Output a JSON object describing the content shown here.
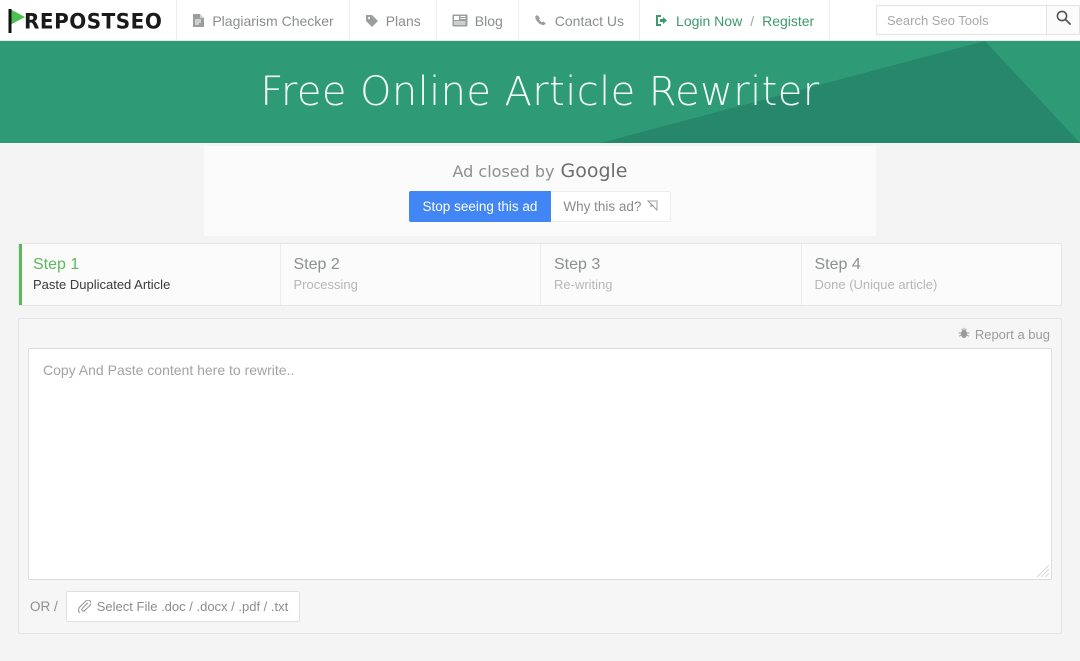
{
  "header": {
    "logo_text": "REPOSTSEO",
    "logo_prefix": "P",
    "nav": [
      {
        "label": "Plagiarism Checker",
        "icon": "document-icon"
      },
      {
        "label": "Plans",
        "icon": "tag-icon"
      },
      {
        "label": "Blog",
        "icon": "newspaper-icon"
      },
      {
        "label": "Contact Us",
        "icon": "phone-icon"
      }
    ],
    "login": {
      "label": "Login Now",
      "separator": "/",
      "register_label": "Register",
      "icon": "sign-in-icon"
    },
    "search": {
      "placeholder": "Search Seo Tools",
      "value": "",
      "icon": "search-icon"
    }
  },
  "hero": {
    "title": "Free Online Article Rewriter",
    "bg_color": "#2e9b76",
    "accent_color": "#27876a"
  },
  "ad": {
    "closed_text": "Ad closed by",
    "brand": "Google",
    "stop_button": "Stop seeing this ad",
    "why_button": "Why this ad?",
    "adchoices_icon": "adchoices-icon",
    "primary_color": "#4285f4"
  },
  "steps": [
    {
      "title": "Step 1",
      "sub": "Paste Duplicated Article",
      "active": true
    },
    {
      "title": "Step 2",
      "sub": "Processing",
      "active": false
    },
    {
      "title": "Step 3",
      "sub": "Re-writing",
      "active": false
    },
    {
      "title": "Step 4",
      "sub": "Done (Unique article)",
      "active": false
    }
  ],
  "panel": {
    "report_bug": "Report a bug",
    "report_bug_icon": "bug-icon",
    "textarea": {
      "placeholder": "Copy And Paste content here to rewrite..",
      "value": ""
    },
    "or_label": "OR /",
    "file_button": "Select File .doc / .docx / .pdf / .txt",
    "file_button_icon": "paperclip-icon"
  },
  "colors": {
    "brand_green": "#3c9a6e",
    "step_active": "#5cb85c",
    "ad_blue": "#4285f4"
  }
}
